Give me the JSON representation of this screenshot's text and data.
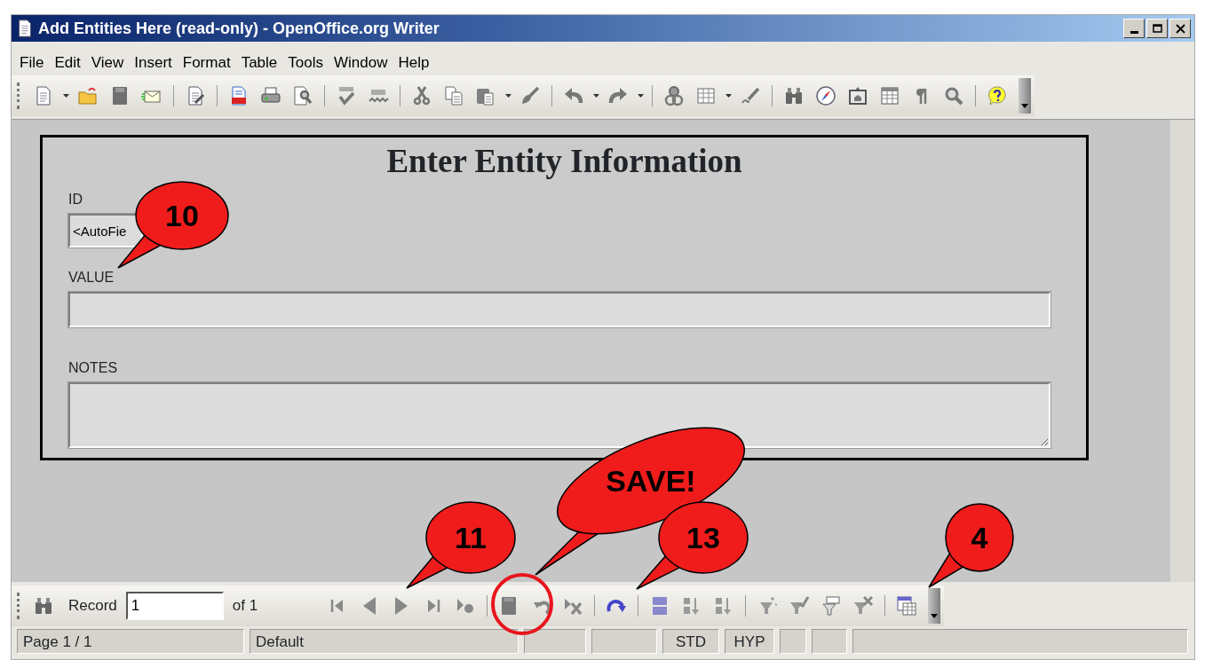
{
  "window": {
    "title": "Add Entities Here (read-only) - OpenOffice.org Writer"
  },
  "menu": [
    {
      "label": "File"
    },
    {
      "label": "Edit"
    },
    {
      "label": "View"
    },
    {
      "label": "Insert"
    },
    {
      "label": "Format"
    },
    {
      "label": "Table"
    },
    {
      "label": "Tools"
    },
    {
      "label": "Window"
    },
    {
      "label": "Help"
    }
  ],
  "form": {
    "title": "Enter Entity Information",
    "fields": [
      {
        "kind": "short",
        "label": "ID",
        "value": "<AutoFie"
      },
      {
        "kind": "line",
        "label": "VALUE"
      },
      {
        "kind": "area",
        "label": "NOTES"
      }
    ]
  },
  "record_bar": {
    "label": "Record",
    "value": "1",
    "total": "of 1"
  },
  "status_bar": {
    "page": "Page 1 / 1",
    "style": "Default",
    "mode": "STD",
    "hyperlink": "HYP"
  },
  "callouts": [
    {
      "text": "10"
    },
    {
      "text": "SAVE!"
    },
    {
      "text": "11"
    },
    {
      "text": "13"
    },
    {
      "text": "4"
    }
  ]
}
